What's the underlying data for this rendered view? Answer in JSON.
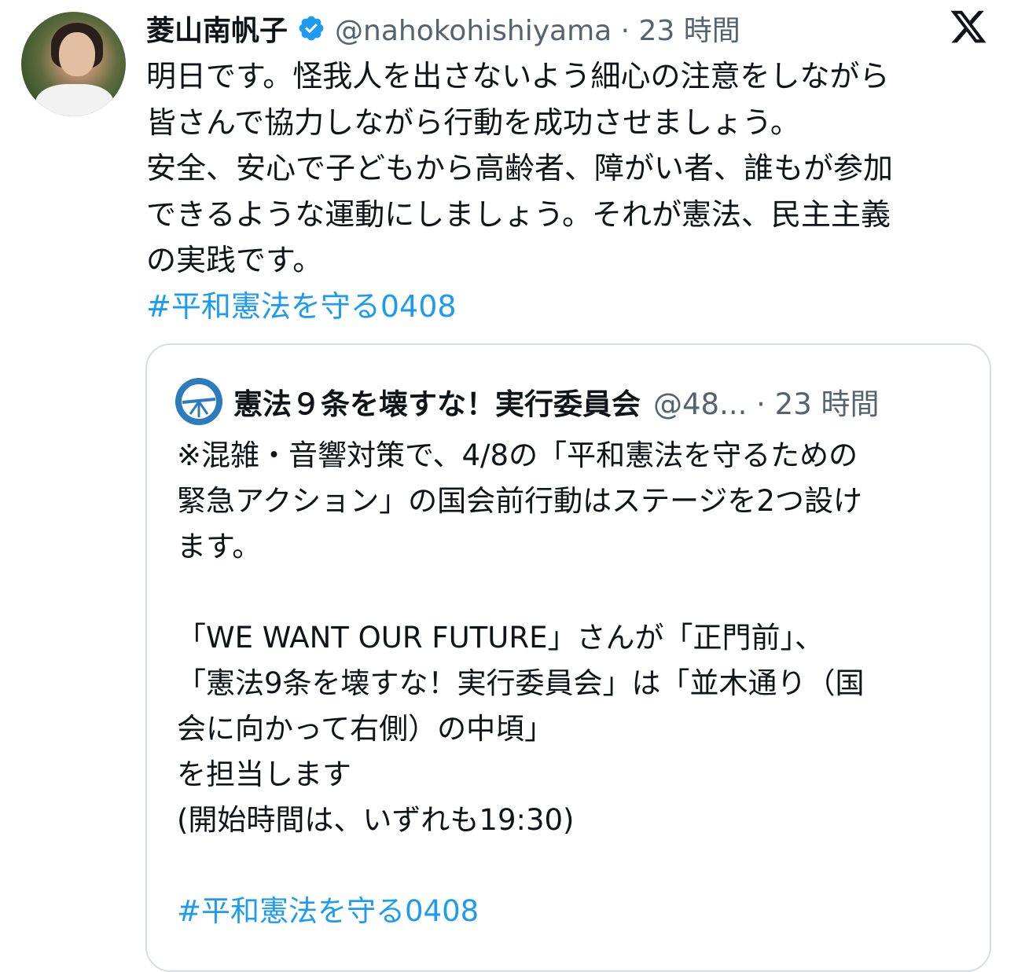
{
  "tweet": {
    "author_name": "菱山南帆子",
    "handle_time": "@nahokohishiyama · 23 時間",
    "verified_icon": "verified-badge-icon",
    "platform_icon": "x-logo-icon",
    "lines": [
      "明日です。怪我人を出さないよう細心の注意をしながら",
      "皆さんで協力しながら行動を成功させましょう。",
      "安全、安心で子どもから高齢者、障がい者、誰もが参加",
      "できるような運動にしましょう。それが憲法、民主主義",
      "の実践です。"
    ],
    "hashtag": "#平和憲法を守る0408"
  },
  "quote": {
    "author_name": "憲法９条を壊すな！実行委員会",
    "handle_time": "@48... · 23 時間",
    "lines": [
      "※混雑・音響対策で、4/8の「平和憲法を守るための",
      "緊急アクション」の国会前行動はステージを2つ設け",
      "ます。",
      "",
      "「WE WANT OUR FUTURE」さんが「正門前」、",
      "「憲法9条を壊すな！実行委員会」は「並木通り（国",
      "会に向かって右側）の中頃」",
      "を担当します",
      "(開始時間は、いずれも19:30)",
      "",
      "#平和憲法を守る0408"
    ]
  },
  "colors": {
    "text": "#0f1419",
    "secondary": "#536471",
    "link": "#1d9bf0",
    "border": "#d6dde3"
  }
}
